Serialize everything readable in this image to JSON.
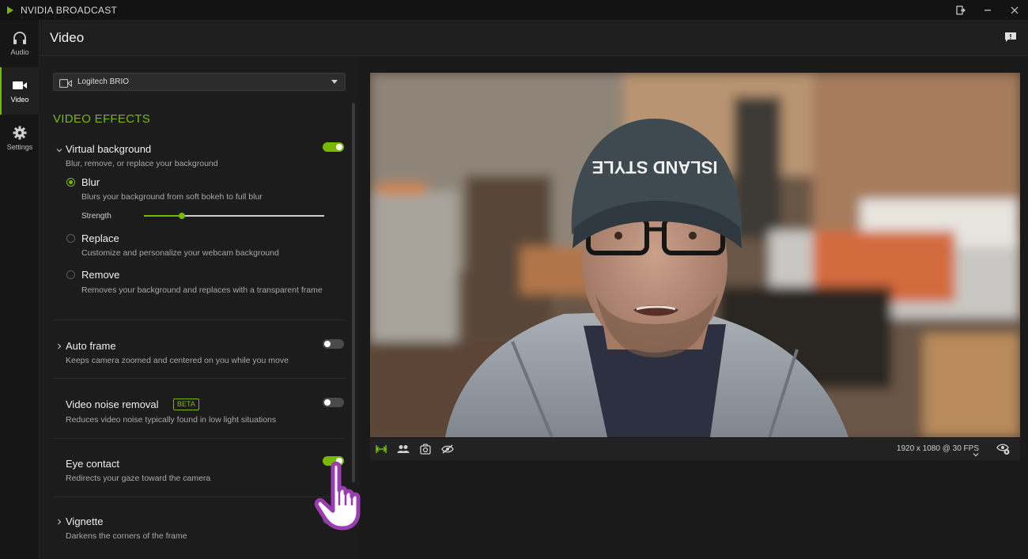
{
  "app": {
    "title": "NVIDIA BROADCAST",
    "brand_color": "#76b900"
  },
  "window_controls": {
    "restore_icon": "exit-mini-icon",
    "minimize_icon": "minimize-icon",
    "close_icon": "close-icon"
  },
  "rail": {
    "items": [
      {
        "label": "Audio",
        "icon": "headphones-icon"
      },
      {
        "label": "Video",
        "icon": "video-camera-icon",
        "active": true
      },
      {
        "label": "Settings",
        "icon": "gear-icon"
      }
    ]
  },
  "header": {
    "title": "Video",
    "feedback_icon": "feedback-icon"
  },
  "device": {
    "name": "Logitech BRIO"
  },
  "effects_section": {
    "title": "VIDEO EFFECTS"
  },
  "effects": {
    "virtual_background": {
      "title": "Virtual background",
      "desc": "Blur, remove, or replace your background",
      "enabled": true,
      "options": {
        "blur": {
          "title": "Blur",
          "desc": "Blurs your background from soft bokeh to full blur",
          "selected": true
        },
        "replace": {
          "title": "Replace",
          "desc": "Customize and personalize your webcam background",
          "selected": false
        },
        "remove": {
          "title": "Remove",
          "desc": "Removes your background and replaces with a transparent frame",
          "selected": false
        }
      },
      "strength": {
        "label": "Strength",
        "value": 0.21
      }
    },
    "auto_frame": {
      "title": "Auto frame",
      "desc": "Keeps camera zoomed and centered on you while you move",
      "enabled": false
    },
    "noise_removal": {
      "title": "Video noise removal",
      "badge": "BETA",
      "desc": "Reduces video noise typically found in low light situations",
      "enabled": false
    },
    "eye_contact": {
      "title": "Eye contact",
      "desc": "Redirects your gaze toward the camera",
      "enabled": true
    },
    "vignette": {
      "title": "Vignette",
      "desc": "Darkens the corners of the frame",
      "enabled": false
    }
  },
  "preview": {
    "hat_text": "ISLAND STYLE",
    "resolution": "1920 x 1080 @ 30 FPS",
    "toolbar_icons": [
      "side-by-side-icon",
      "people-icon",
      "snapshot-icon",
      "hide-preview-icon",
      "eye-settings-icon"
    ]
  }
}
